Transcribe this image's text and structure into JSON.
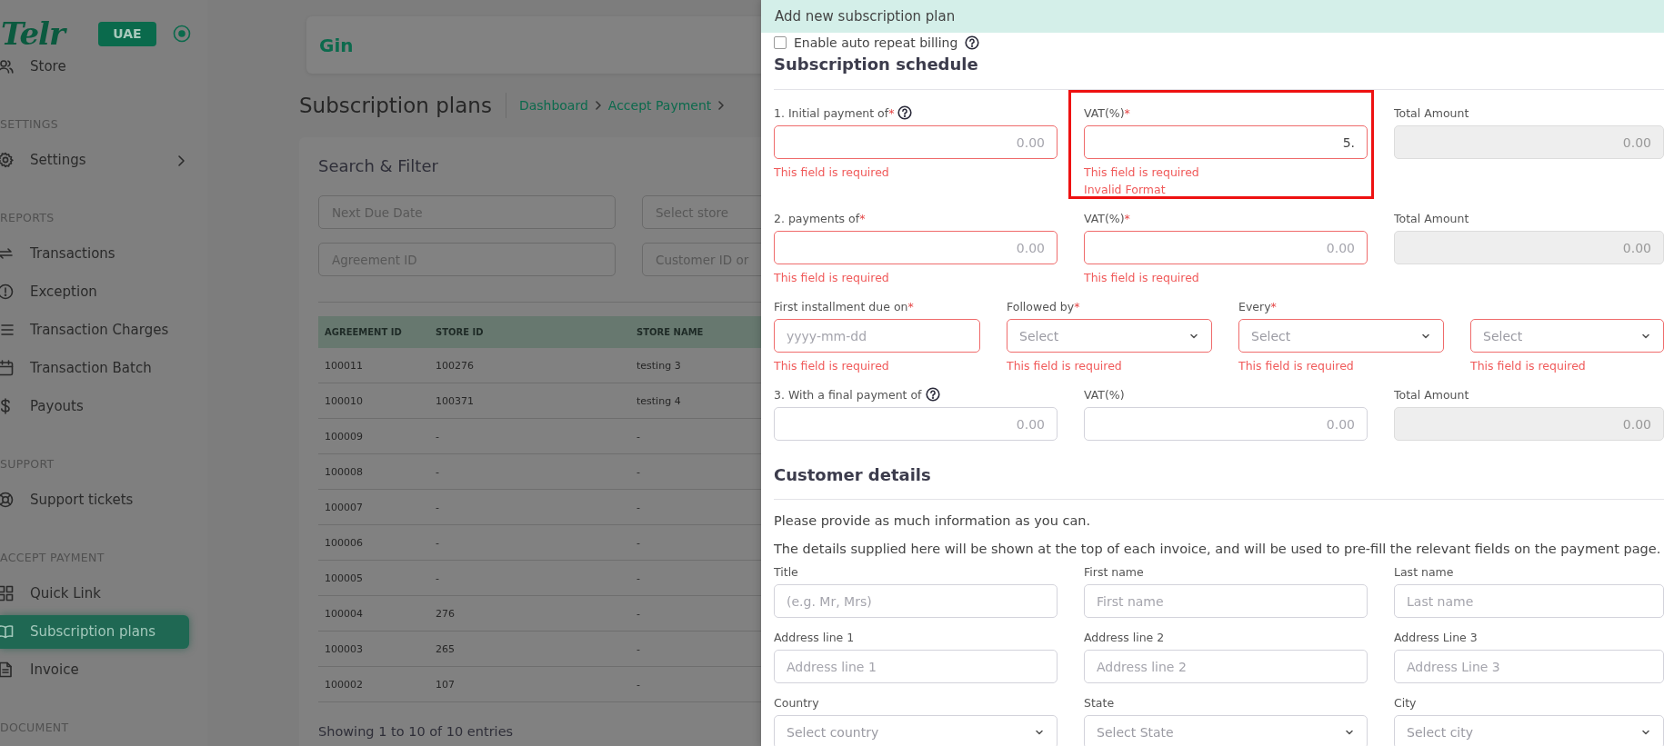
{
  "sidebar": {
    "logo": "Telr",
    "region": "UAE",
    "items": [
      {
        "kind": "link",
        "label": "Store",
        "selected": false,
        "submenu": false
      },
      {
        "kind": "heading",
        "label": "SETTINGS"
      },
      {
        "kind": "link",
        "label": "Settings",
        "selected": false,
        "submenu": true
      },
      {
        "kind": "heading",
        "label": "REPORTS"
      },
      {
        "kind": "link",
        "label": "Transactions",
        "selected": false,
        "submenu": false
      },
      {
        "kind": "link",
        "label": "Exception",
        "selected": false,
        "submenu": false
      },
      {
        "kind": "link",
        "label": "Transaction Charges",
        "selected": false,
        "submenu": false
      },
      {
        "kind": "link",
        "label": "Transaction Batch",
        "selected": false,
        "submenu": false
      },
      {
        "kind": "link",
        "label": "Payouts",
        "selected": false,
        "submenu": false
      },
      {
        "kind": "heading",
        "label": "SUPPORT"
      },
      {
        "kind": "link",
        "label": "Support tickets",
        "selected": false,
        "submenu": false
      },
      {
        "kind": "heading",
        "label": "ACCEPT PAYMENT"
      },
      {
        "kind": "link",
        "label": "Quick Link",
        "selected": false,
        "submenu": false
      },
      {
        "kind": "link",
        "label": "Subscription plans",
        "selected": true,
        "submenu": false
      },
      {
        "kind": "link",
        "label": "Invoice",
        "selected": false,
        "submenu": false
      },
      {
        "kind": "heading",
        "label": "DOCUMENT"
      }
    ]
  },
  "store_card": {
    "name": "Gin"
  },
  "page": {
    "title": "Subscription plans",
    "breadcrumb": [
      "Dashboard",
      "Accept Payment"
    ]
  },
  "filter": {
    "title": "Search & Filter",
    "fields": [
      {
        "placeholder": "Next Due Date"
      },
      {
        "placeholder": "Select store"
      },
      {
        "placeholder": "Agreement ID"
      },
      {
        "placeholder": "Customer ID or"
      }
    ]
  },
  "table": {
    "columns": [
      "AGREEMENT ID",
      "STORE ID",
      "STORE NAME"
    ],
    "rows": [
      [
        "100011",
        "100276",
        "testing 3"
      ],
      [
        "100010",
        "100371",
        "testing 4"
      ],
      [
        "100009",
        "-",
        "-"
      ],
      [
        "100008",
        "-",
        "-"
      ],
      [
        "100007",
        "-",
        "-"
      ],
      [
        "100006",
        "-",
        "-"
      ],
      [
        "100005",
        "-",
        "-"
      ],
      [
        "100004",
        "276",
        "-"
      ],
      [
        "100003",
        "265",
        "-"
      ],
      [
        "100002",
        "107",
        "-"
      ]
    ],
    "footer": "Showing 1 to 10 of 10 entries"
  },
  "drawer": {
    "title": "Add new subscription plan",
    "auto_repeat": {
      "label": "Enable auto repeat billing",
      "checked": false,
      "help": true
    },
    "schedule": {
      "title": "Subscription schedule",
      "rows": [
        {
          "fields": [
            {
              "kind": "amount",
              "label": "1. Initial payment of",
              "mark": "*",
              "help": true,
              "placeholder": "0.00",
              "invalid": true,
              "disabled": false,
              "annotated": false,
              "errors": [
                "This field is required"
              ]
            },
            {
              "kind": "amount",
              "label": "VAT(%)",
              "mark": "*",
              "help": false,
              "value": "5.",
              "invalid": true,
              "disabled": false,
              "annotated": true,
              "errors": [
                "This field is required",
                "Invalid Format"
              ]
            },
            {
              "kind": "amount",
              "label": "Total Amount",
              "help": false,
              "placeholder": "0.00",
              "invalid": false,
              "disabled": true,
              "annotated": false
            }
          ]
        },
        {
          "fields": [
            {
              "kind": "amount",
              "label": "2. payments of",
              "mark": "*",
              "help": false,
              "placeholder": "0.00",
              "invalid": true,
              "disabled": false,
              "annotated": false,
              "errors": [
                "This field is required"
              ]
            },
            {
              "kind": "amount",
              "label": "VAT(%)",
              "mark": "*",
              "help": false,
              "placeholder": "0.00",
              "invalid": true,
              "disabled": false,
              "annotated": false,
              "errors": [
                "This field is required"
              ]
            },
            {
              "kind": "amount",
              "label": "Total Amount",
              "help": false,
              "placeholder": "0.00",
              "invalid": false,
              "disabled": true,
              "annotated": false
            }
          ]
        },
        {
          "fields": [
            {
              "kind": "date",
              "label": "First installment due on",
              "mark": "*",
              "help": false,
              "placeholder": "yyyy-mm-dd",
              "invalid": true,
              "disabled": false,
              "annotated": false,
              "errors": [
                "This field is required"
              ]
            },
            {
              "kind": "select",
              "label": "Followed by",
              "mark": "*",
              "help": false,
              "placeholder": "Select",
              "invalid": true,
              "disabled": false,
              "annotated": false,
              "errors": [
                "This field is required"
              ]
            },
            {
              "kind": "select",
              "label": "Every",
              "mark": "*",
              "help": false,
              "placeholder": "Select",
              "invalid": true,
              "disabled": false,
              "annotated": false,
              "errors": [
                "This field is required"
              ]
            },
            {
              "kind": "select",
              "help": false,
              "placeholder": "Select",
              "invalid": true,
              "disabled": false,
              "annotated": false,
              "errors": [
                "This field is required"
              ]
            }
          ]
        },
        {
          "fields": [
            {
              "kind": "amount",
              "label": "3. With a final payment of",
              "help": true,
              "placeholder": "0.00",
              "invalid": false,
              "disabled": false,
              "annotated": false
            },
            {
              "kind": "amount",
              "label": "VAT(%)",
              "help": false,
              "placeholder": "0.00",
              "invalid": false,
              "disabled": false,
              "annotated": false
            },
            {
              "kind": "amount",
              "label": "Total Amount",
              "help": false,
              "placeholder": "0.00",
              "invalid": false,
              "disabled": true,
              "annotated": false
            }
          ]
        }
      ]
    },
    "customer": {
      "title": "Customer details",
      "notes": [
        "Please provide as much information as you can.",
        "The details supplied here will be shown at the top of each invoice, and will be used to pre-fill the relevant fields on the payment page."
      ],
      "fields": [
        {
          "kind": "input",
          "label": "Title",
          "placeholder": "(e.g. Mr, Mrs)"
        },
        {
          "kind": "input",
          "label": "First name",
          "placeholder": "First name"
        },
        {
          "kind": "input",
          "label": "Last name",
          "placeholder": "Last name"
        },
        {
          "kind": "input",
          "label": "Address line 1",
          "placeholder": "Address line 1"
        },
        {
          "kind": "input",
          "label": "Address line 2",
          "placeholder": "Address line 2"
        },
        {
          "kind": "input",
          "label": "Address Line 3",
          "placeholder": "Address Line 3"
        },
        {
          "kind": "select",
          "label": "Country",
          "placeholder": "Select country"
        },
        {
          "kind": "select",
          "label": "State",
          "placeholder": "Select State"
        },
        {
          "kind": "select",
          "label": "City",
          "placeholder": "Select city"
        }
      ]
    }
  }
}
